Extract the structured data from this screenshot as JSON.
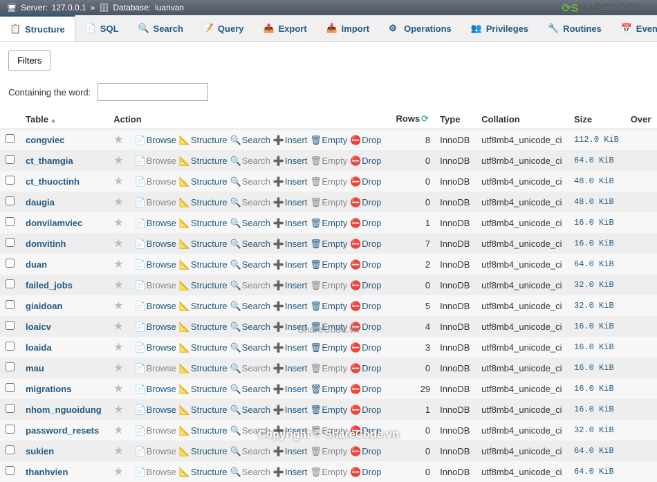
{
  "breadcrumb": {
    "server_label": "Server:",
    "server": "127.0.0.1",
    "db_label": "Database:",
    "db": "luanvan"
  },
  "tabs": [
    {
      "label": "Structure",
      "active": true
    },
    {
      "label": "SQL"
    },
    {
      "label": "Search"
    },
    {
      "label": "Query"
    },
    {
      "label": "Export"
    },
    {
      "label": "Import"
    },
    {
      "label": "Operations"
    },
    {
      "label": "Privileges"
    },
    {
      "label": "Routines"
    },
    {
      "label": "Event"
    }
  ],
  "filters": {
    "button": "Filters",
    "label": "Containing the word:",
    "value": ""
  },
  "headers": {
    "table": "Table",
    "action": "Action",
    "rows": "Rows",
    "type": "Type",
    "collation": "Collation",
    "size": "Size",
    "overhead": "Over"
  },
  "actions": {
    "browse": "Browse",
    "structure": "Structure",
    "search": "Search",
    "insert": "Insert",
    "empty": "Empty",
    "drop": "Drop"
  },
  "tables": [
    {
      "name": "congviec",
      "rows": 8,
      "type": "InnoDB",
      "collation": "utf8mb4_unicode_ci",
      "size": "112.0 KiB",
      "muted": false
    },
    {
      "name": "ct_thamgia",
      "rows": 0,
      "type": "InnoDB",
      "collation": "utf8mb4_unicode_ci",
      "size": "64.0 KiB",
      "muted": true
    },
    {
      "name": "ct_thuoctinh",
      "rows": 0,
      "type": "InnoDB",
      "collation": "utf8mb4_unicode_ci",
      "size": "48.0 KiB",
      "muted": true
    },
    {
      "name": "daugia",
      "rows": 0,
      "type": "InnoDB",
      "collation": "utf8mb4_unicode_ci",
      "size": "48.0 KiB",
      "muted": true
    },
    {
      "name": "donvilamviec",
      "rows": 1,
      "type": "InnoDB",
      "collation": "utf8mb4_unicode_ci",
      "size": "16.0 KiB",
      "muted": false
    },
    {
      "name": "donvitinh",
      "rows": 7,
      "type": "InnoDB",
      "collation": "utf8mb4_unicode_ci",
      "size": "16.0 KiB",
      "muted": false
    },
    {
      "name": "duan",
      "rows": 2,
      "type": "InnoDB",
      "collation": "utf8mb4_unicode_ci",
      "size": "64.0 KiB",
      "muted": false
    },
    {
      "name": "failed_jobs",
      "rows": 0,
      "type": "InnoDB",
      "collation": "utf8mb4_unicode_ci",
      "size": "32.0 KiB",
      "muted": true
    },
    {
      "name": "giaidoan",
      "rows": 5,
      "type": "InnoDB",
      "collation": "utf8mb4_unicode_ci",
      "size": "32.0 KiB",
      "muted": false
    },
    {
      "name": "loaicv",
      "rows": 4,
      "type": "InnoDB",
      "collation": "utf8mb4_unicode_ci",
      "size": "16.0 KiB",
      "muted": false
    },
    {
      "name": "loaida",
      "rows": 3,
      "type": "InnoDB",
      "collation": "utf8mb4_unicode_ci",
      "size": "16.0 KiB",
      "muted": false
    },
    {
      "name": "mau",
      "rows": 0,
      "type": "InnoDB",
      "collation": "utf8mb4_unicode_ci",
      "size": "16.0 KiB",
      "muted": true
    },
    {
      "name": "migrations",
      "rows": 29,
      "type": "InnoDB",
      "collation": "utf8mb4_unicode_ci",
      "size": "16.0 KiB",
      "muted": false
    },
    {
      "name": "nhom_nguoidung",
      "rows": 1,
      "type": "InnoDB",
      "collation": "utf8mb4_unicode_ci",
      "size": "16.0 KiB",
      "muted": false
    },
    {
      "name": "password_resets",
      "rows": 0,
      "type": "InnoDB",
      "collation": "utf8mb4_unicode_ci",
      "size": "32.0 KiB",
      "muted": true
    },
    {
      "name": "sukien",
      "rows": 0,
      "type": "InnoDB",
      "collation": "utf8mb4_unicode_ci",
      "size": "64.0 KiB",
      "muted": true
    },
    {
      "name": "thanhvien",
      "rows": 0,
      "type": "InnoDB",
      "collation": "utf8mb4_unicode_ci",
      "size": "64.0 KiB",
      "muted": true
    }
  ],
  "watermark": {
    "logo": "SHARECODE.vn",
    "center": "ShareCode.vn",
    "copyright": "Copyright © ShareCode.vn"
  }
}
